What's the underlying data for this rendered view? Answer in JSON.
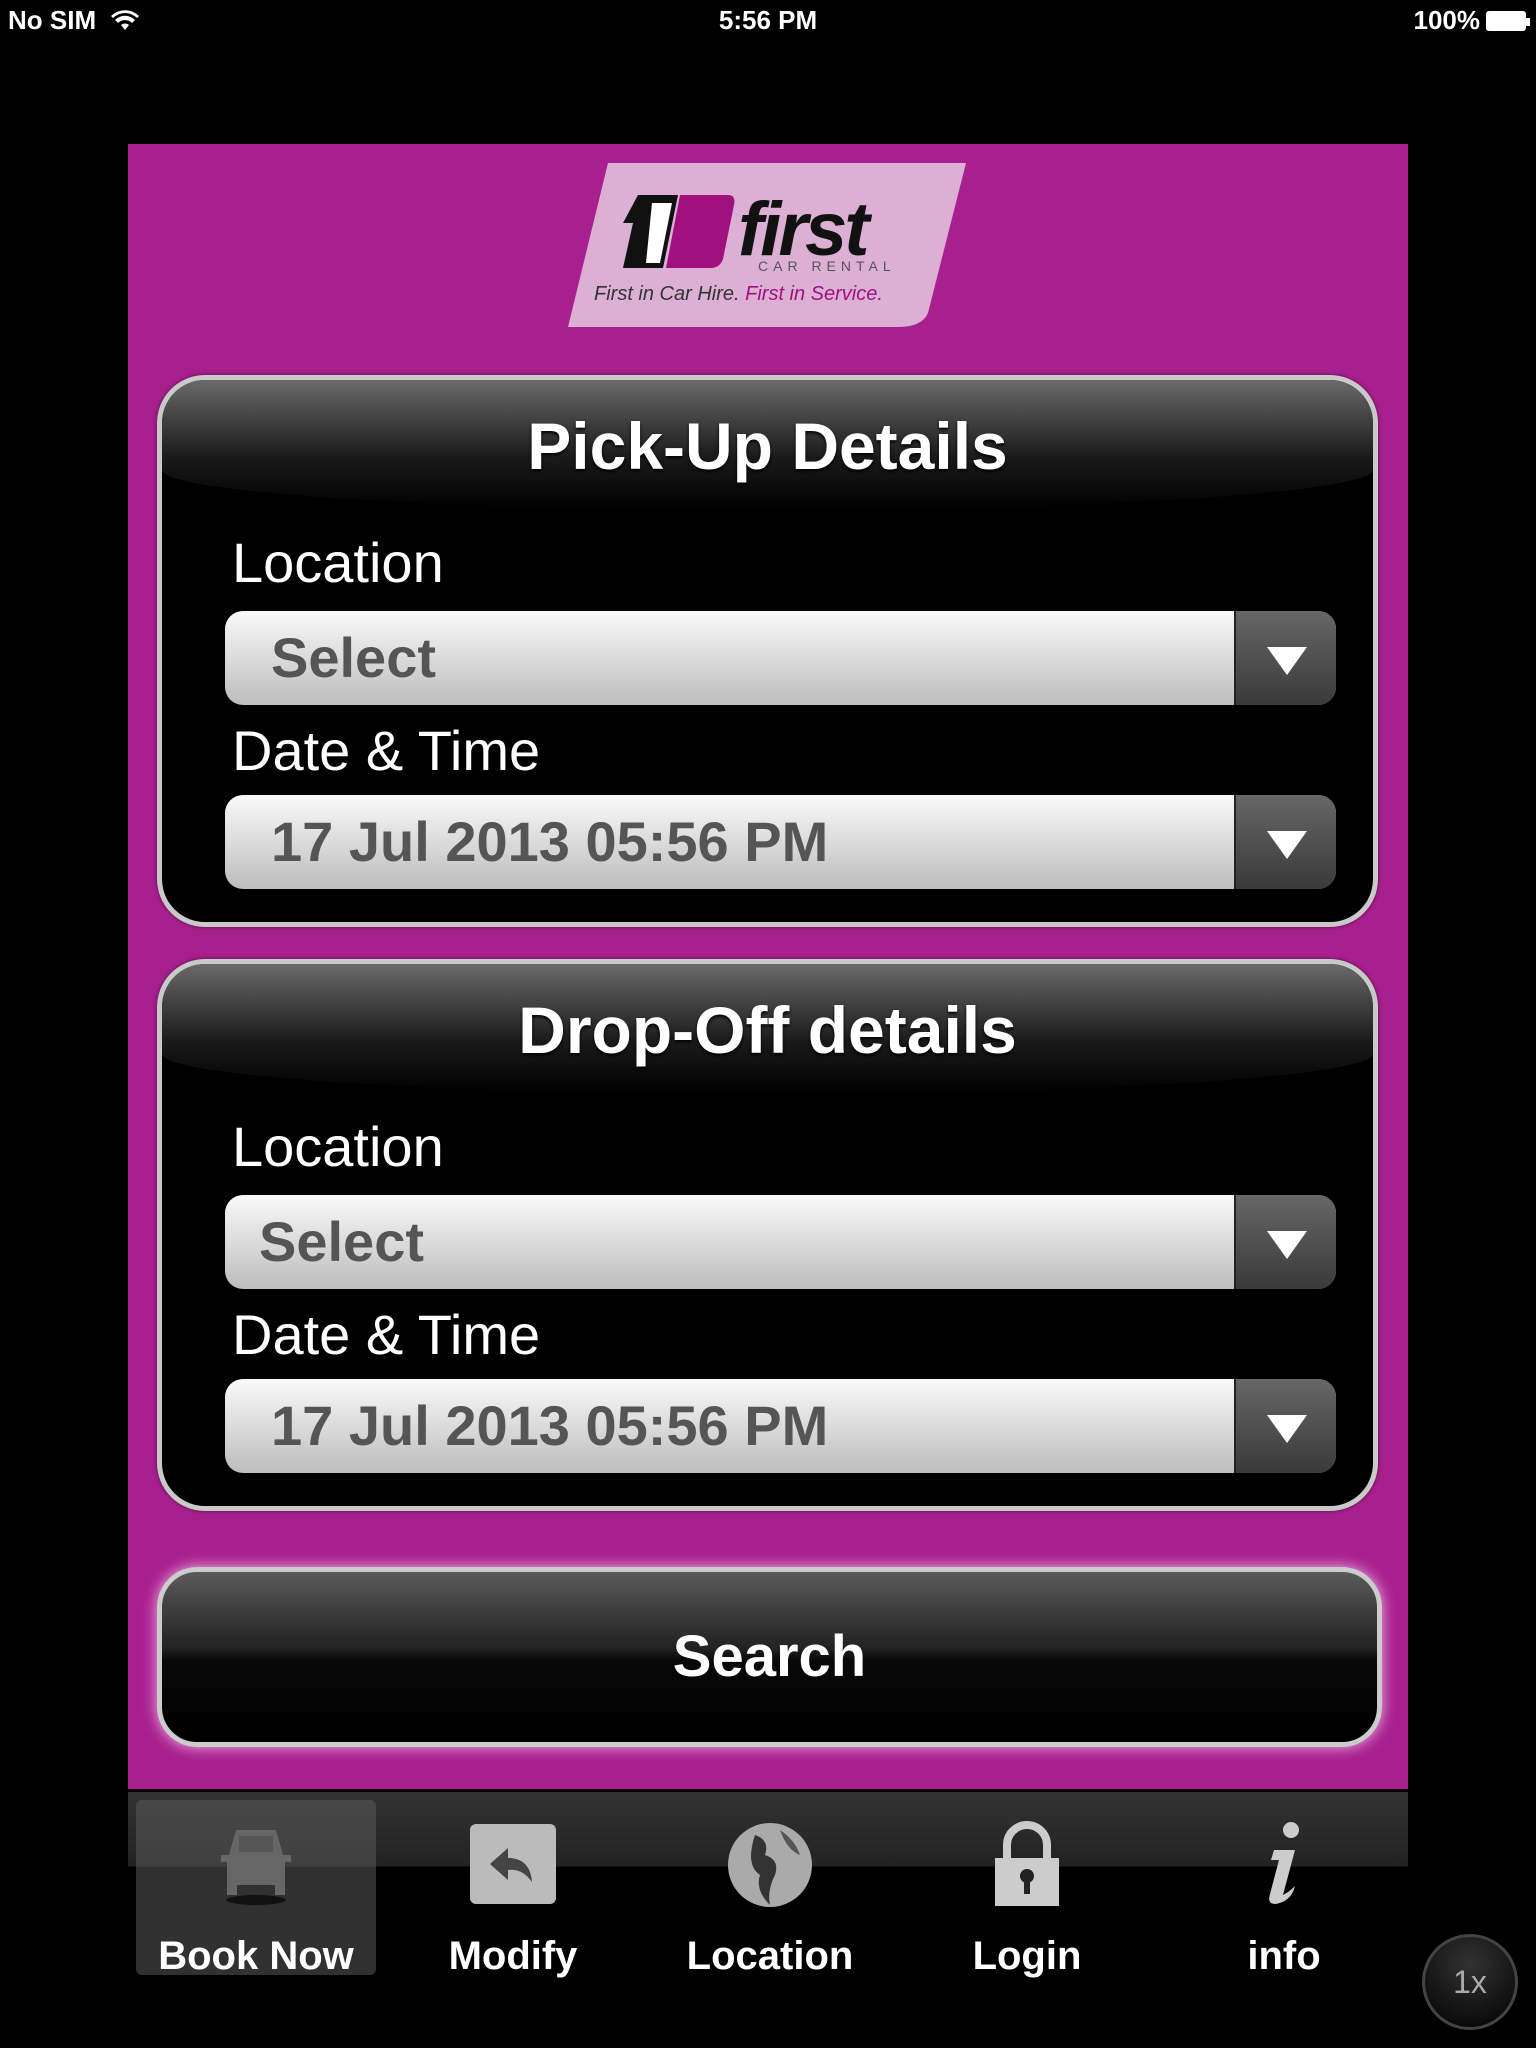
{
  "status_bar": {
    "carrier": "No SIM",
    "time": "5:56 PM",
    "battery": "100%"
  },
  "logo": {
    "brand": "first",
    "sub": "CAR RENTAL",
    "tagline_a": "First in Car Hire.",
    "tagline_b": "First in Service.",
    "colors": {
      "purple": "#a8208e",
      "logo_bg": "#dcb0d4"
    }
  },
  "pickup": {
    "title": "Pick-Up Details",
    "location_label": "Location",
    "location_value": "Select",
    "datetime_label": "Date & Time",
    "datetime_value": "17 Jul 2013 05:56 PM"
  },
  "dropoff": {
    "title": "Drop-Off details",
    "location_label": "Location",
    "location_value": "Select",
    "datetime_label": "Date & Time",
    "datetime_value": "17 Jul 2013 05:56 PM"
  },
  "search_label": "Search",
  "tabs": [
    {
      "label": "Book Now",
      "icon": "car-icon",
      "active": true
    },
    {
      "label": "Modify",
      "icon": "reply-arrow-icon"
    },
    {
      "label": "Location",
      "icon": "globe-icon"
    },
    {
      "label": "Login",
      "icon": "lock-icon"
    },
    {
      "label": "info",
      "icon": "info-icon"
    }
  ],
  "zoom_label": "1x"
}
